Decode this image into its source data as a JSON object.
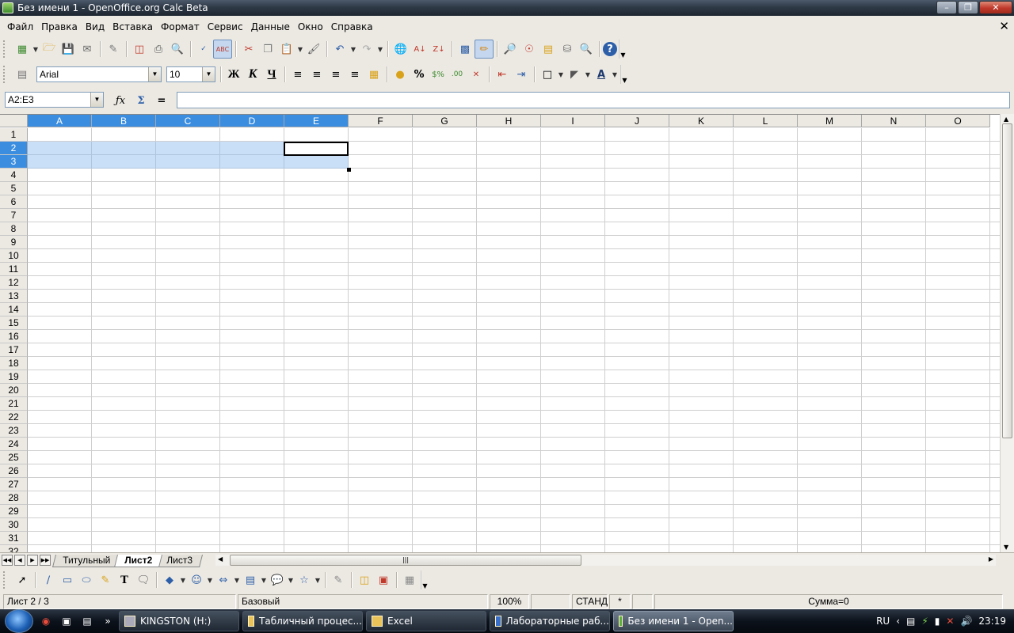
{
  "window": {
    "title": "Без имени 1 - OpenOffice.org Calc Beta"
  },
  "menu": [
    "Файл",
    "Правка",
    "Вид",
    "Вставка",
    "Формат",
    "Сервис",
    "Данные",
    "Окно",
    "Справка"
  ],
  "format_bar": {
    "font_name": "Arial",
    "font_size": "10",
    "bold_label": "Ж",
    "italic_label": "К",
    "underline_label": "Ч"
  },
  "formula_bar": {
    "name_box": "A2:E3",
    "input": ""
  },
  "grid": {
    "columns": [
      "A",
      "B",
      "C",
      "D",
      "E",
      "F",
      "G",
      "H",
      "I",
      "J",
      "K",
      "L",
      "M",
      "N",
      "O"
    ],
    "selected_columns": [
      "A",
      "B",
      "C",
      "D",
      "E"
    ],
    "rows": [
      "1",
      "2",
      "3",
      "4",
      "5",
      "6",
      "7",
      "8",
      "9",
      "10",
      "11",
      "12",
      "13",
      "14",
      "15",
      "16",
      "17",
      "18",
      "19",
      "20",
      "21",
      "22",
      "23",
      "24",
      "25",
      "26",
      "27",
      "28",
      "29",
      "30",
      "31",
      "32"
    ],
    "selected_rows": [
      "2",
      "3"
    ],
    "active_cell": "E2"
  },
  "sheet_tabs": [
    {
      "label": "Титульный",
      "active": false
    },
    {
      "label": "Лист2",
      "active": true
    },
    {
      "label": "Лист3",
      "active": false
    }
  ],
  "status_bar": {
    "sheet": "Лист 2 / 3",
    "page_style": "Базовый",
    "zoom": "100%",
    "mode": "СТАНД",
    "modified": "*",
    "sum": "Сумма=0"
  },
  "taskbar": {
    "tasks": [
      {
        "label": "KINGSTON (H:)",
        "active": false
      },
      {
        "label": "Табличный процес...",
        "active": false
      },
      {
        "label": "Excel",
        "active": false
      },
      {
        "label": "Лабораторные раб...",
        "active": false
      },
      {
        "label": "Без имени 1 - Open...",
        "active": true
      }
    ],
    "language": "RU",
    "clock": "23:19"
  },
  "colors": {
    "selection_header": "#3b8de0",
    "selection_fill": "#c6dcf5",
    "title_bar": "#2f3a47"
  }
}
